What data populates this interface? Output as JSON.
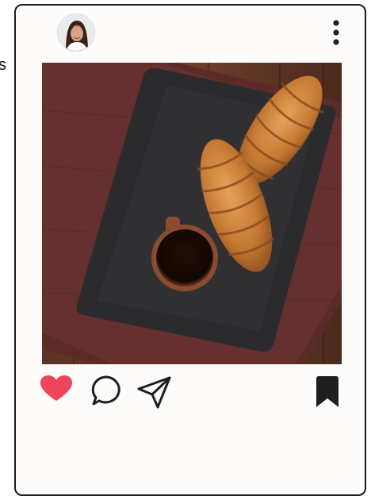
{
  "edge_fragment": "s",
  "post": {
    "menu_icon": "more-vertical-icon",
    "avatar_icon": "profile-avatar",
    "photo_subject": "croissants-and-coffee",
    "actions": {
      "like_icon": "heart-icon",
      "comment_icon": "comment-bubble-icon",
      "share_icon": "paper-plane-icon",
      "save_icon": "bookmark-icon",
      "liked": true
    }
  },
  "colors": {
    "like_red": "#f0445a",
    "icon_dark": "#1f1f1f",
    "card_border": "#1b1b1b",
    "card_bg": "#fdfcfb"
  }
}
